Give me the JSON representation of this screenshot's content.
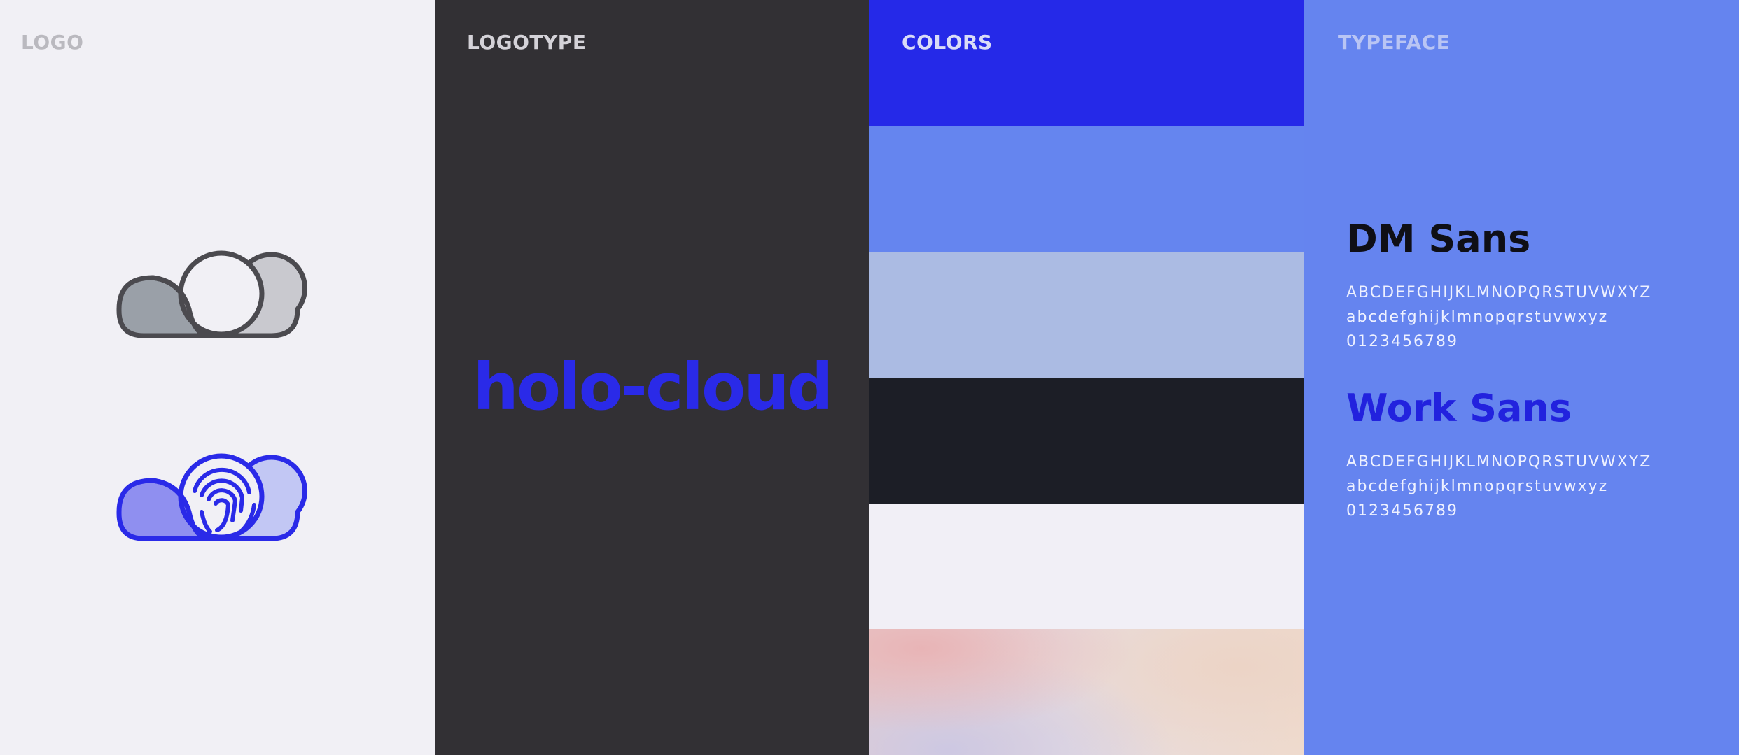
{
  "panels": {
    "logo": {
      "label": "LOGO"
    },
    "logotype": {
      "label": "LOGOTYPE",
      "wordmark": "holo-cloud"
    },
    "colors": {
      "label": "COLORS",
      "swatches": [
        "#2529e8",
        "#6585ef",
        "#abbbe3",
        "#1c1e26",
        "#f1eff6",
        "gradient"
      ]
    },
    "typeface": {
      "label": "TYPEFACE",
      "fonts": [
        {
          "name": "DM Sans",
          "upper": "ABCDEFGHIJKLMNOPQRSTUVWXYZ",
          "lower": "abcdefghijklmnopqrstuvwxyz",
          "digits": "0123456789"
        },
        {
          "name": "Work Sans",
          "upper": "ABCDEFGHIJKLMNOPQRSTUVWXYZ",
          "lower": "abcdefghijklmnopqrstuvwxyz",
          "digits": "0123456789"
        }
      ]
    }
  },
  "icons": {
    "logo_outline": "cloud-outline-icon",
    "logo_fingerprint": "cloud-fingerprint-icon"
  },
  "colors": {
    "logo_bg": "#f1f0f5",
    "logotype_bg": "#323034",
    "typeface_bg": "#6584ef",
    "accent": "#2a2ae8",
    "outline": "#4b4a4f"
  }
}
